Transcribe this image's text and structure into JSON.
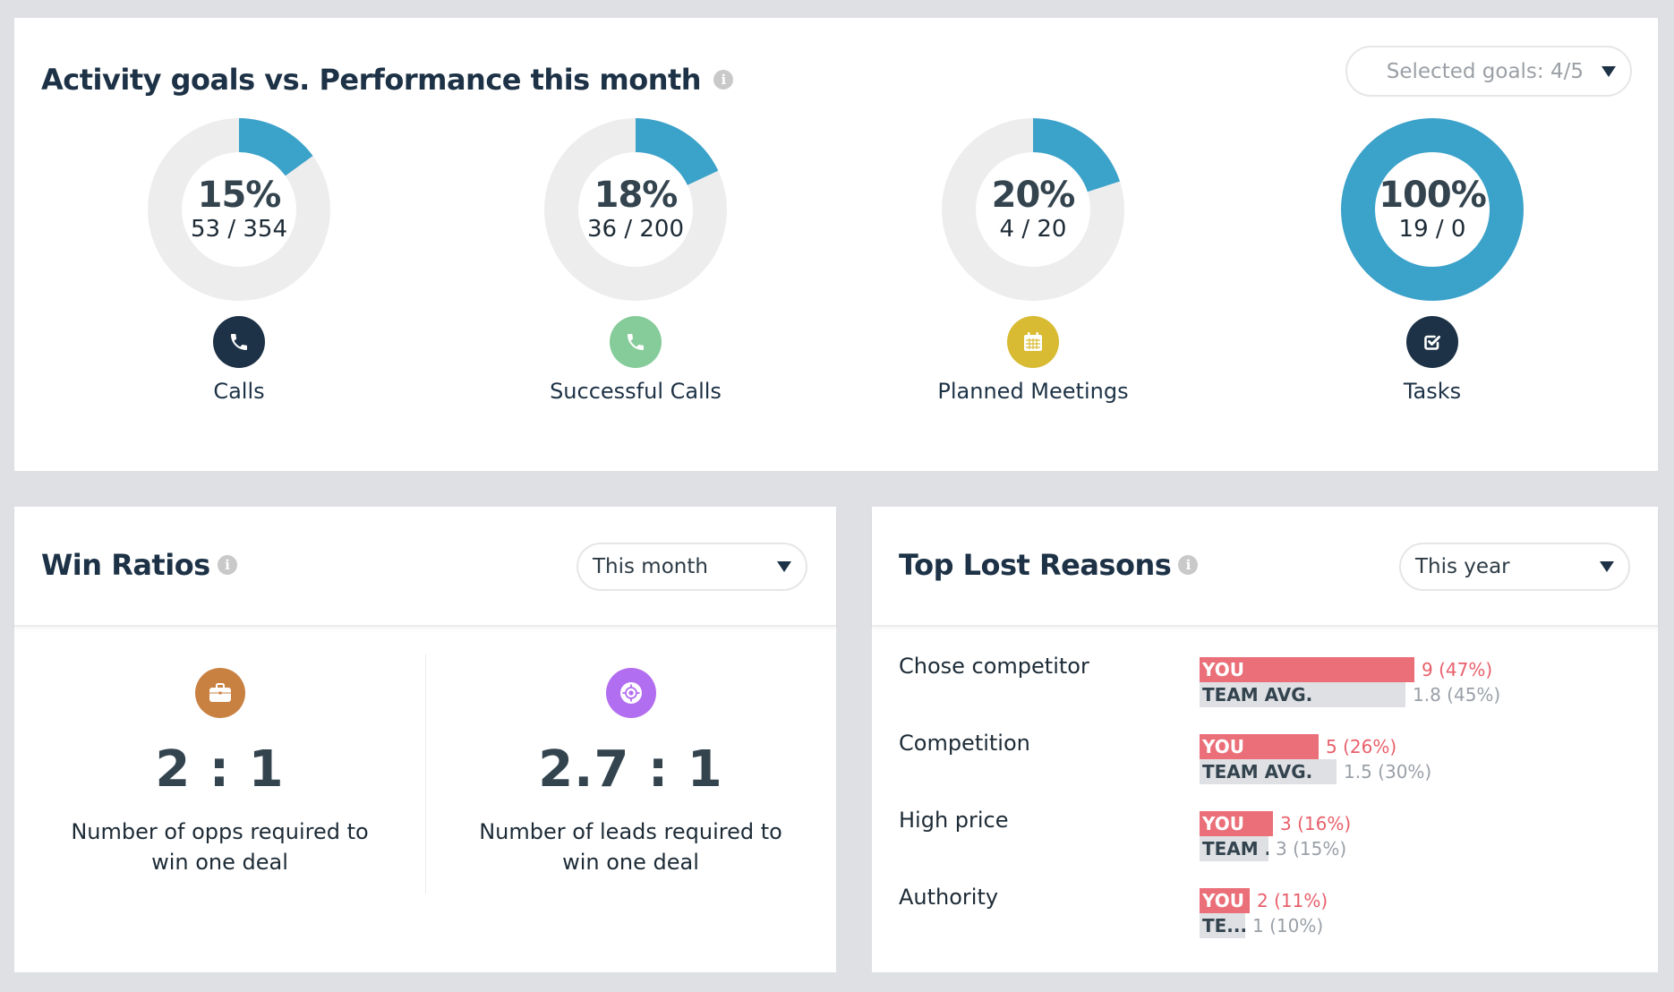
{
  "goals_panel": {
    "title": "Activity goals vs. Performance this month",
    "info_icon": "i",
    "dropdown_label": "Selected goals: 4/5",
    "goals": [
      {
        "name": "Calls",
        "percent_label": "15%",
        "progress": 0.15,
        "ratio_label": "53 / 354",
        "icon": "phone-icon",
        "icon_color": "#1d3246"
      },
      {
        "name": "Successful Calls",
        "percent_label": "18%",
        "progress": 0.18,
        "ratio_label": "36 / 200",
        "icon": "phone-icon",
        "icon_color": "#86cc9a"
      },
      {
        "name": "Planned Meetings",
        "percent_label": "20%",
        "progress": 0.2,
        "ratio_label": "4 / 20",
        "icon": "calendar-icon",
        "icon_color": "#d8bb32"
      },
      {
        "name": "Tasks",
        "percent_label": "100%",
        "progress": 1.0,
        "ratio_label": "19 / 0",
        "icon": "checkbox-icon",
        "icon_color": "#1d3246"
      }
    ],
    "colors": {
      "progress": "#3ba2ca",
      "track": "#ededed"
    }
  },
  "win_ratios": {
    "title": "Win Ratios",
    "info_icon": "i",
    "period": "This month",
    "items": [
      {
        "icon": "briefcase-icon",
        "icon_color": "#c98142",
        "value": "2 : 1",
        "description": "Number of opps required to win one deal"
      },
      {
        "icon": "target-icon",
        "icon_color": "#b26ef0",
        "value": "2.7 : 1",
        "description": "Number of leads required to win one deal"
      }
    ]
  },
  "lost_reasons": {
    "title": "Top Lost Reasons",
    "info_icon": "i",
    "period": "This year",
    "you_label": "YOU",
    "colors": {
      "you": "#ea6f78",
      "team": "#dfe0e4"
    },
    "rows": [
      {
        "reason": "Chose competitor",
        "you_count": 9,
        "you_value": "9 (47%)",
        "team_label": "TEAM AVG.",
        "team_count": 1.8,
        "team_value": "1.8 (45%)"
      },
      {
        "reason": "Competition",
        "you_count": 5,
        "you_value": "5 (26%)",
        "team_label": "TEAM AVG.",
        "team_count": 1.5,
        "team_value": "1.5 (30%)"
      },
      {
        "reason": "High price",
        "you_count": 3,
        "you_value": "3 (16%)",
        "team_label": "TEAM ...",
        "team_count": 3,
        "team_value": "3 (15%)"
      },
      {
        "reason": "Authority",
        "you_count": 2,
        "you_value": "2 (11%)",
        "team_label": "TE...",
        "team_count": 1,
        "team_value": "1 (10%)"
      }
    ]
  }
}
